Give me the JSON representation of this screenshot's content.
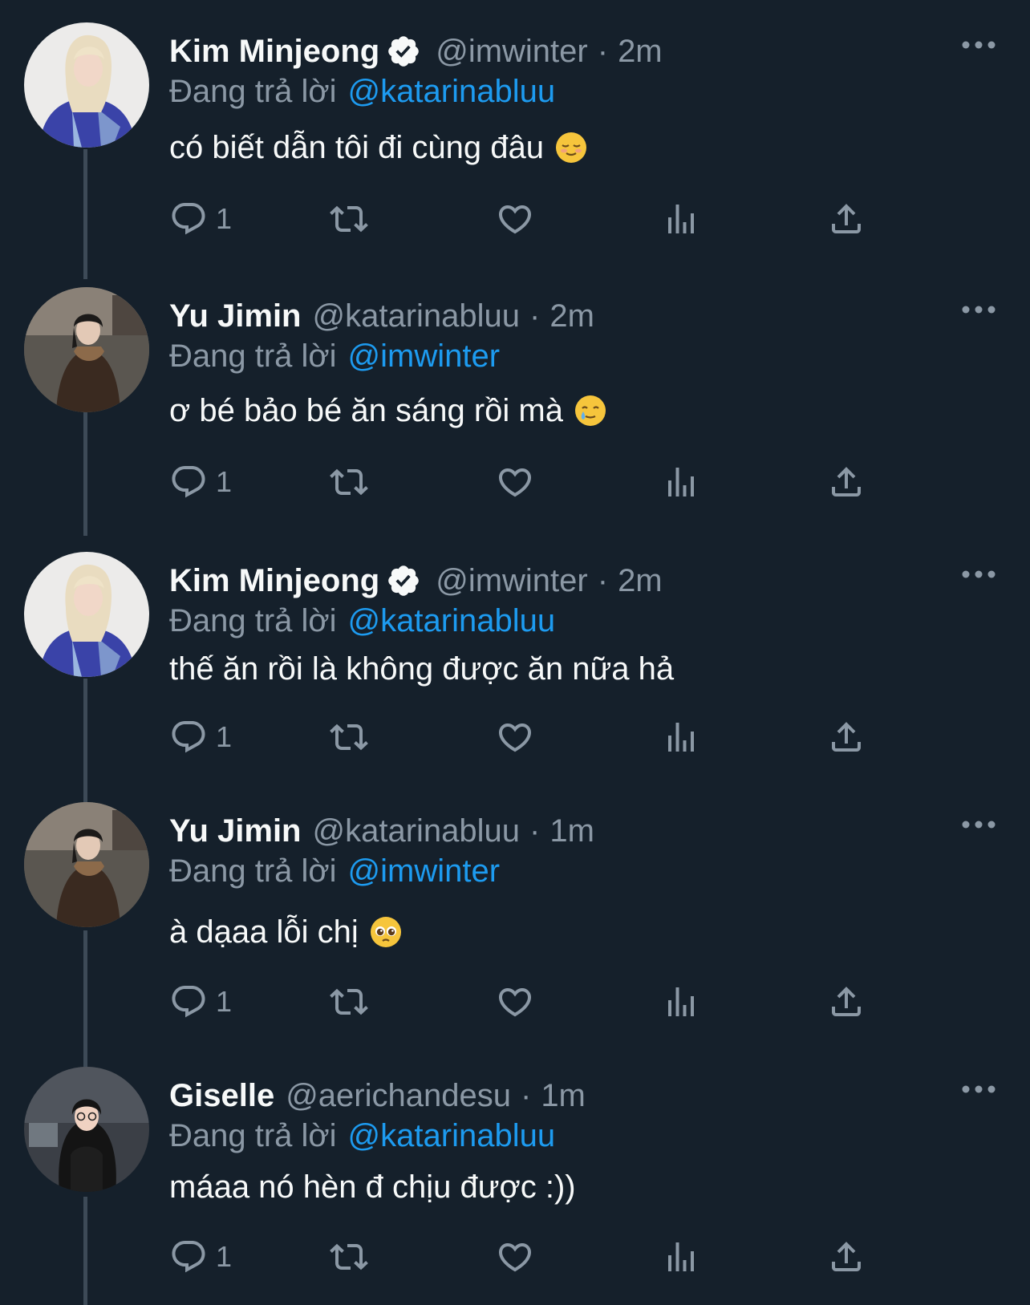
{
  "thread": [
    {
      "name": "Kim Minjeong",
      "verified": true,
      "handle": "@imwinter",
      "separator": "·",
      "time": "2m",
      "reply_prefix": "Đang trả lời",
      "reply_to": "@katarinabluu",
      "text": "có biết dẫn tôi đi cùng đâu",
      "emoji": "relieved-face",
      "reply_count": "1",
      "avatar": "blonde-woman-blue-sweater"
    },
    {
      "name": "Yu Jimin",
      "verified": false,
      "handle": "@katarinabluu",
      "separator": "·",
      "time": "2m",
      "reply_prefix": "Đang trả lời",
      "reply_to": "@imwinter",
      "text": "ơ bé bảo bé ăn sáng rồi mà",
      "emoji": "smiling-face-with-tear",
      "reply_count": "1",
      "avatar": "woman-brown-coat-street"
    },
    {
      "name": "Kim Minjeong",
      "verified": true,
      "handle": "@imwinter",
      "separator": "·",
      "time": "2m",
      "reply_prefix": "Đang trả lời",
      "reply_to": "@katarinabluu",
      "text": "thế ăn rồi là không được ăn nữa hả",
      "emoji": "",
      "reply_count": "1",
      "avatar": "blonde-woman-blue-sweater"
    },
    {
      "name": "Yu Jimin",
      "verified": false,
      "handle": "@katarinabluu",
      "separator": "·",
      "time": "1m",
      "reply_prefix": "Đang trả lời",
      "reply_to": "@imwinter",
      "text": "à dạaa lỗi chị",
      "emoji": "pleading-face",
      "reply_count": "1",
      "avatar": "woman-brown-coat-street"
    },
    {
      "name": "Giselle",
      "verified": false,
      "handle": "@aerichandesu",
      "separator": "·",
      "time": "1m",
      "reply_prefix": "Đang trả lời",
      "reply_to": "@katarinabluu",
      "text": "máaa nó hèn đ chịu được :))",
      "emoji": "",
      "reply_count": "1",
      "avatar": "dark-hair-woman-glasses"
    }
  ],
  "colors": {
    "background": "#15202b",
    "primary_text": "#f7f9f9",
    "secondary_text": "#8b98a5",
    "link": "#1d9bf0",
    "thread_line": "#3d4a57"
  }
}
